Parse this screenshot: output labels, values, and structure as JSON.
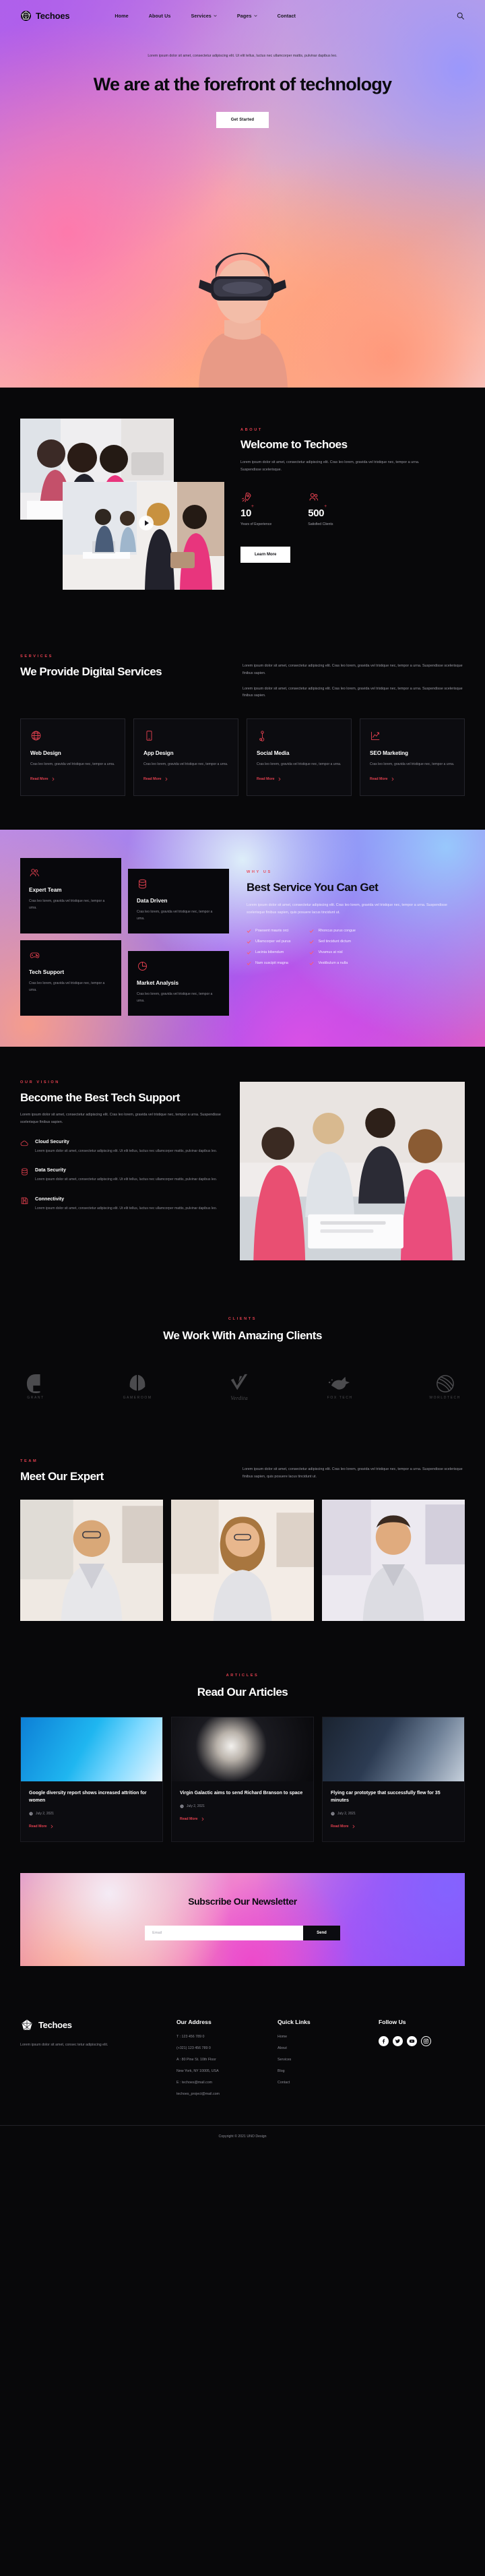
{
  "brand": {
    "name": "Techoes",
    "logo_icon": "polyhedron-logo-icon"
  },
  "nav": {
    "items": [
      {
        "label": "Home",
        "active": true,
        "caret": false
      },
      {
        "label": "About Us",
        "active": false,
        "caret": false
      },
      {
        "label": "Services",
        "active": false,
        "caret": true
      },
      {
        "label": "Pages",
        "active": false,
        "caret": true
      },
      {
        "label": "Contact",
        "active": false,
        "caret": false
      }
    ],
    "search_icon": "search-icon"
  },
  "hero": {
    "subtitle": "Lorem ipsum dolor sit amet, consectetur adipiscing elit. Ut elit tellus, luctus nec ullamcorper mattis, pulvinar dapibus leo.",
    "title": "We are at the forefront of technology",
    "cta": "Get Started"
  },
  "about": {
    "eyebrow": "ABOUT",
    "title": "Welcome to Techoes",
    "text": "Lorem ipsum dolor sit amet, consectetur adipiscing elit. Cras leo lorem, gravida vel tristique nec, tempor a urna. Suspendisse scelerisque.",
    "stats": [
      {
        "icon": "rocket-icon",
        "value": "10",
        "suffix": "+",
        "label": "Years of Experience"
      },
      {
        "icon": "users-icon",
        "value": "500",
        "suffix": "+",
        "label": "Satisfied Clients"
      }
    ],
    "cta": "Learn More",
    "play_icon": "play-icon"
  },
  "services": {
    "eyebrow": "SERVICES",
    "title": "We Provide Digital Services",
    "paragraphs": [
      "Lorem ipsum dolor sit amet, consectetur adipiscing elit. Cras leo lorem, gravida vel tristique nec, tempor a urna. Suspendisse scelerisque finibus sapien.",
      "Lorem ipsum dolor sit amet, consectetur adipiscing elit. Cras leo lorem, gravida vel tristique nec, tempor a urna. Suspendisse scelerisque finibus sapien."
    ],
    "read_more": "Read More",
    "cards": [
      {
        "icon": "globe-icon",
        "title": "Web Design",
        "text": "Cras leo lorem, gravida vel tristique nec, tempor a urna."
      },
      {
        "icon": "mobile-icon",
        "title": "App Design",
        "text": "Cras leo lorem, gravida vel tristique nec, tempor a urna."
      },
      {
        "icon": "share-icon",
        "title": "Social Media",
        "text": "Cras leo lorem, gravida vel tristique nec, tempor a urna."
      },
      {
        "icon": "chart-up-icon",
        "title": "SEO Marketing",
        "text": "Cras leo lorem, gravida vel tristique nec, tempor a urna."
      }
    ]
  },
  "whyus": {
    "eyebrow": "WHY US",
    "title": "Best Service You Can Get",
    "text": "Lorem ipsum dolor sit amet, consectetur adipiscing elit. Cras leo lorem, gravida vel tristique nec, tempor a urna. Suspendisse scelerisque finibus sapien, quis posuere lacus tincidunt ut.",
    "cards": [
      {
        "icon": "team-icon",
        "title": "Expert Team",
        "text": "Cras leo lorem, gravida vel tristique nec, tempor a urna."
      },
      {
        "icon": "database-icon",
        "title": "Data Driven",
        "text": "Cras leo lorem, gravida vel tristique nec, tempor a urna."
      },
      {
        "icon": "gamepad-icon",
        "title": "Tech Support",
        "text": "Cras leo lorem, gravida vel tristique nec, tempor a urna."
      },
      {
        "icon": "pie-chart-icon",
        "title": "Market Analysis",
        "text": "Cras leo lorem, gravida vel tristique nec, tempor a urna."
      }
    ],
    "list_left": [
      "Praesent mauris orci",
      "Ullamcorper vel purus",
      "Lacinia bibendum",
      "Nam suscipit magna"
    ],
    "list_right": [
      "Rhoncus purus congue",
      "Sed tincidunt dictum",
      "Vivamus at nisl",
      "Vestibulum a nulla"
    ]
  },
  "vision": {
    "eyebrow": "OUR VISION",
    "title": "Become the Best Tech Support",
    "text": "Lorem ipsum dolor sit amet, consectetur adipiscing elit. Cras leo lorem, gravida vel tristique nec, tempor a urna. Suspendisse scelerisque finibus sapien.",
    "features": [
      {
        "icon": "cloud-icon",
        "title": "Cloud Security",
        "text": "Lorem ipsum dolor sit amet, consectetur adipiscing elit. Ut elit tellus, luctus nec ullamcorper mattis, pulvinar dapibus leo."
      },
      {
        "icon": "database-icon",
        "title": "Data Security",
        "text": "Lorem ipsum dolor sit amet, consectetur adipiscing elit. Ut elit tellus, luctus nec ullamcorper mattis, pulvinar dapibus leo."
      },
      {
        "icon": "save-icon",
        "title": "Connectivity",
        "text": "Lorem ipsum dolor sit amet, consectetur adipiscing elit. Ut elit tellus, luctus nec ullamcorper mattis, pulvinar dapibus leo."
      }
    ]
  },
  "clients": {
    "eyebrow": "CLIENTS",
    "title": "We Work With Amazing Clients",
    "logos": [
      {
        "name": "GRANT",
        "mark": "letter-g-icon"
      },
      {
        "name": "GAMEROOM",
        "mark": "split-shield-icon"
      },
      {
        "name": "Verdita",
        "mark": "check-swoosh-icon"
      },
      {
        "name": "FOX TECH",
        "mark": "fox-icon"
      },
      {
        "name": "WORLDTECH",
        "mark": "globe-sphere-icon"
      }
    ]
  },
  "team": {
    "eyebrow": "TEAM",
    "title": "Meet Our Expert",
    "text": "Lorem ipsum dolor sit amet, consectetur adipiscing elit. Cras leo lorem, gravida vel tristique nec, tempor a urna. Suspendisse scelerisque finibus sapien, quis posuere lacus tincidunt ut.",
    "members": [
      {
        "photo": "team-photo-1"
      },
      {
        "photo": "team-photo-2"
      },
      {
        "photo": "team-photo-3"
      }
    ]
  },
  "articles": {
    "eyebrow": "ARTICLES",
    "title": "Read Our Articles",
    "read_more": "Read More",
    "clock_icon": "clock-icon",
    "items": [
      {
        "title": "Google diversity report shows increased attrition for women",
        "date": "July 2, 2021"
      },
      {
        "title": "Virgin Galactic aims to send Richard Branson to space",
        "date": "July 2, 2021"
      },
      {
        "title": "Flying car prototype that successfully flew for 35 minutes",
        "date": "July 2, 2021"
      }
    ]
  },
  "newsletter": {
    "title": "Subscribe Our Newsletter",
    "placeholder": "Email",
    "value": "",
    "button": "Send"
  },
  "footer": {
    "brand_name": "Techoes",
    "about": "Lorem ipsum dolor sit amet, consec tetur adipiscing elit.",
    "address": {
      "title": "Our Address",
      "lines": [
        "T : 123 456 789 0",
        "(+321) 123 456 789 0",
        "A : 80 Pine St. 10th Floor",
        "New York, NY 10005, USA",
        "E : techoes@mail.com",
        "techoes_project@mail.com"
      ]
    },
    "quick_links": {
      "title": "Quick Links",
      "items": [
        "Home",
        "About",
        "Services",
        "Blog",
        "Contact"
      ]
    },
    "follow": {
      "title": "Follow Us",
      "socials": [
        "facebook-icon",
        "twitter-icon",
        "youtube-icon",
        "instagram-icon"
      ]
    },
    "copyright": "Copyright © 2021 UNO Design"
  },
  "colors": {
    "accent": "#e4404f",
    "bg": "#08080a",
    "text": "#ffffff",
    "muted": "#8d8d96"
  }
}
